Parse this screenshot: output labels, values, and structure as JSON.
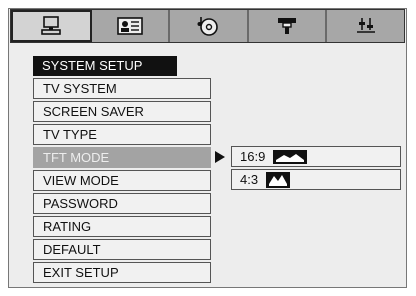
{
  "tabs": [
    {
      "icon": "computer-icon",
      "active": true
    },
    {
      "icon": "id-card-icon",
      "active": false
    },
    {
      "icon": "disc-music-icon",
      "active": false
    },
    {
      "icon": "speaker-icon",
      "active": false
    },
    {
      "icon": "equalizer-icon",
      "active": false
    }
  ],
  "menu": {
    "title": "SYSTEM SETUP",
    "items": [
      {
        "label": "TV SYSTEM"
      },
      {
        "label": "SCREEN SAVER"
      },
      {
        "label": "TV TYPE"
      },
      {
        "label": "TFT MODE",
        "selected": true
      },
      {
        "label": "VIEW MODE"
      },
      {
        "label": "PASSWORD"
      },
      {
        "label": "RATING"
      },
      {
        "label": "DEFAULT"
      },
      {
        "label": "EXIT SETUP"
      }
    ]
  },
  "submenu": {
    "items": [
      {
        "label": "16:9",
        "icon": "widescreen-aspect-icon"
      },
      {
        "label": "4:3",
        "icon": "standard-aspect-icon"
      }
    ]
  }
}
